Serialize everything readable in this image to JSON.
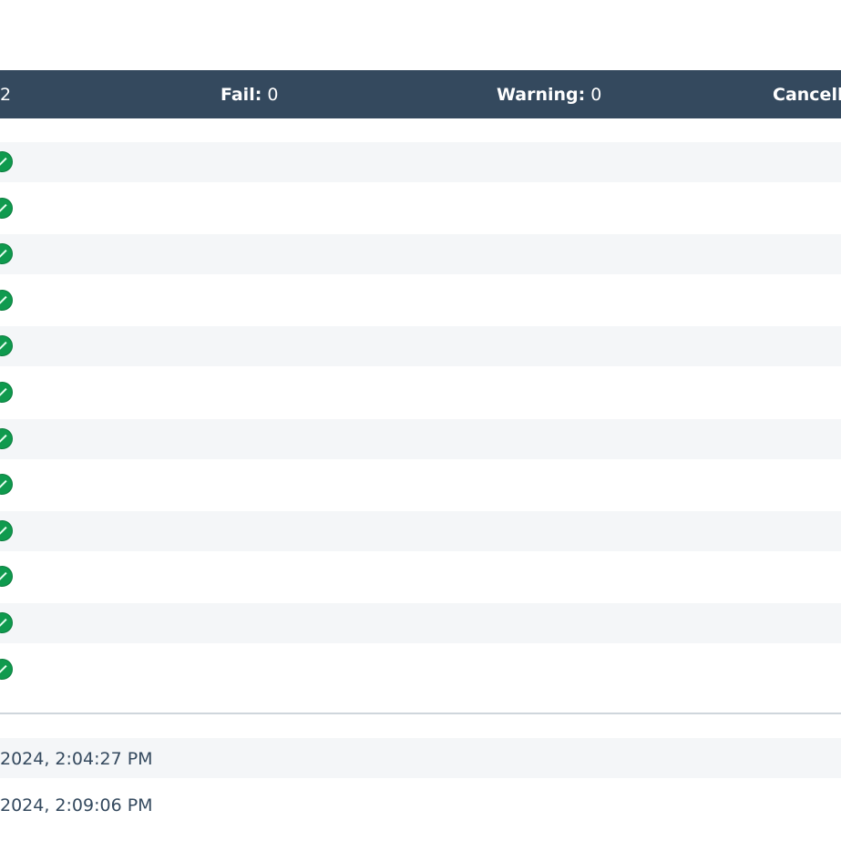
{
  "summary": {
    "pass_value": "2",
    "fail_label": "Fail:",
    "fail_value": "0",
    "warning_label": "Warning:",
    "warning_value": "0",
    "cancelled_label": "Cancelle"
  },
  "results": [
    {
      "status": "pass"
    },
    {
      "status": "pass"
    },
    {
      "status": "pass"
    },
    {
      "status": "pass"
    },
    {
      "status": "pass"
    },
    {
      "status": "pass"
    },
    {
      "status": "pass"
    },
    {
      "status": "pass"
    },
    {
      "status": "pass"
    },
    {
      "status": "pass"
    },
    {
      "status": "pass"
    },
    {
      "status": "pass"
    }
  ],
  "times": {
    "start": "2024, 2:04:27 PM",
    "end": "2024, 2:09:06 PM"
  },
  "colors": {
    "header_bg": "#34495e",
    "pass_green": "#0f9a4e",
    "stripe": "#f4f6f8"
  },
  "icons": {
    "status": "check-circle-icon"
  }
}
